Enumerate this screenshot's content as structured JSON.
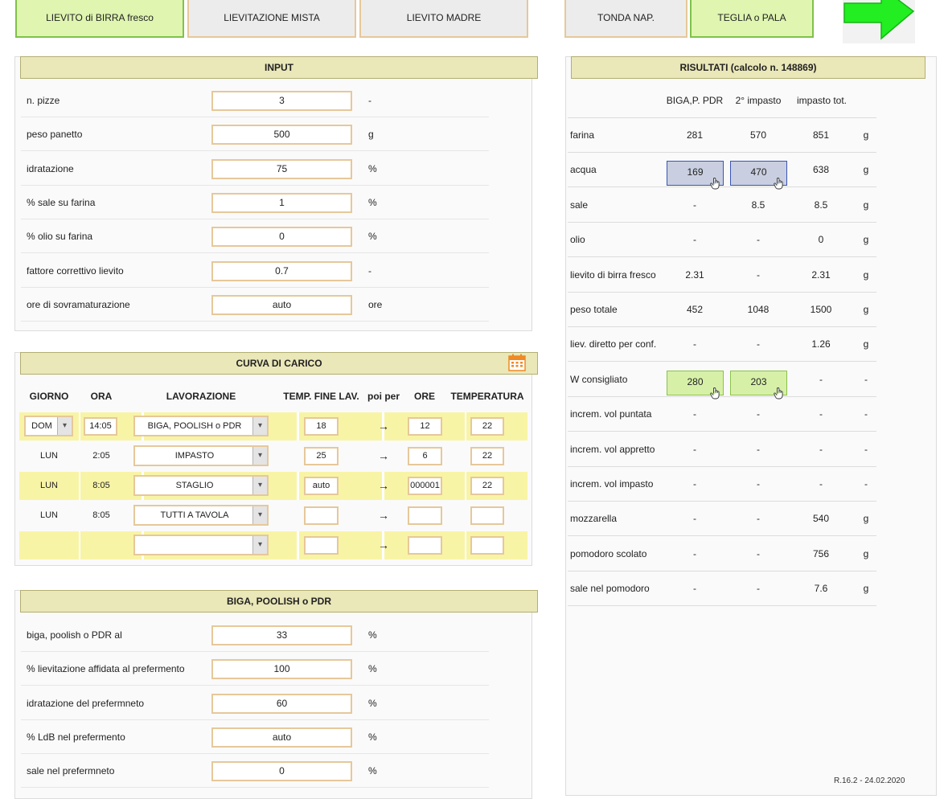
{
  "top_buttons": [
    {
      "label": "LIEVITO di BIRRA fresco",
      "state": "active"
    },
    {
      "label": "LIEVITAZIONE MISTA",
      "state": "normal"
    },
    {
      "label": "LIEVITO MADRE",
      "state": "normal"
    },
    {
      "label": "TONDA NAP.",
      "state": "normal"
    },
    {
      "label": "TEGLIA o PALA",
      "state": "active"
    }
  ],
  "next_button": {
    "icon": "arrow-right-icon",
    "color": "#22ee22"
  },
  "input": {
    "title": "INPUT",
    "rows": [
      {
        "label": "n. pizze",
        "value": "3",
        "unit": "-"
      },
      {
        "label": "peso panetto",
        "value": "500",
        "unit": "g"
      },
      {
        "label": "idratazione",
        "value": "75",
        "unit": "%"
      },
      {
        "label": "% sale su farina",
        "value": "1",
        "unit": "%"
      },
      {
        "label": "% olio su farina",
        "value": "0",
        "unit": "%"
      },
      {
        "label": "fattore correttivo lievito",
        "value": "0.7",
        "unit": "-"
      },
      {
        "label": "ore di sovramaturazione",
        "value": "auto",
        "unit": "ore"
      }
    ]
  },
  "curva": {
    "title": "CURVA DI CARICO",
    "calendar_icon": "calendar-icon",
    "headers": {
      "giorno": "GIORNO",
      "ora": "ORA",
      "lavorazione": "LAVORAZIONE",
      "temp_fine": "TEMP. FINE LAV.",
      "poi_per": "poi per",
      "ore": "ORE",
      "temperatura": "TEMPERATURA"
    },
    "arrow": "→",
    "rows": [
      {
        "giorno": "DOM",
        "ora": "14:05",
        "lavorazione": "BIGA, POOLISH o PDR",
        "temp_fine": "18",
        "ore": "12",
        "temperatura": "22"
      },
      {
        "giorno": "LUN",
        "ora": "2:05",
        "lavorazione": "IMPASTO",
        "temp_fine": "25",
        "ore": "6",
        "temperatura": "22"
      },
      {
        "giorno": "LUN",
        "ora": "8:05",
        "lavorazione": "STAGLIO",
        "temp_fine": "auto",
        "ore": "000001",
        "temperatura": "22"
      },
      {
        "giorno": "LUN",
        "ora": "8:05",
        "lavorazione": "TUTTI A TAVOLA",
        "temp_fine": "",
        "ore": "",
        "temperatura": ""
      },
      {
        "giorno": "",
        "ora": "",
        "lavorazione": "",
        "temp_fine": "",
        "ore": "",
        "temperatura": ""
      }
    ]
  },
  "biga": {
    "title": "BIGA, POOLISH o PDR",
    "rows": [
      {
        "label": "biga, poolish o PDR al",
        "value": "33",
        "unit": "%"
      },
      {
        "label": "% lievitazione affidata al prefermento",
        "value": "100",
        "unit": "%"
      },
      {
        "label": "idratazione del prefermneto",
        "value": "60",
        "unit": "%"
      },
      {
        "label": "% LdB nel prefermento",
        "value": "auto",
        "unit": "%"
      },
      {
        "label": "sale nel prefermneto",
        "value": "0",
        "unit": "%"
      }
    ]
  },
  "results": {
    "title": "RISULTATI (calcolo n. 148869)",
    "col_headers": [
      "BIGA,P. PDR",
      "2° impasto",
      "impasto tot."
    ],
    "rows": [
      {
        "label": "farina",
        "biga": "281",
        "secondo": "570",
        "tot": "851",
        "unit": "g",
        "style": "plain"
      },
      {
        "label": "acqua",
        "biga": "169",
        "secondo": "470",
        "tot": "638",
        "unit": "g",
        "style": "blue"
      },
      {
        "label": "sale",
        "biga": "-",
        "secondo": "8.5",
        "tot": "8.5",
        "unit": "g",
        "style": "plain"
      },
      {
        "label": "olio",
        "biga": "-",
        "secondo": "-",
        "tot": "0",
        "unit": "g",
        "style": "plain"
      },
      {
        "label": "lievito di birra fresco",
        "biga": "2.31",
        "secondo": "-",
        "tot": "2.31",
        "unit": "g",
        "style": "plain"
      },
      {
        "label": "peso totale",
        "biga": "452",
        "secondo": "1048",
        "tot": "1500",
        "unit": "g",
        "style": "plain"
      },
      {
        "label": "liev. diretto per conf.",
        "biga": "-",
        "secondo": "-",
        "tot": "1.26",
        "unit": "g",
        "style": "plain"
      },
      {
        "label": "W consigliato",
        "biga": "280",
        "secondo": "203",
        "tot": "-",
        "unit": "-",
        "style": "green"
      },
      {
        "label": "increm. vol puntata",
        "biga": "-",
        "secondo": "-",
        "tot": "-",
        "unit": "-",
        "style": "plain"
      },
      {
        "label": "increm. vol appretto",
        "biga": "-",
        "secondo": "-",
        "tot": "-",
        "unit": "-",
        "style": "plain"
      },
      {
        "label": "increm. vol impasto",
        "biga": "-",
        "secondo": "-",
        "tot": "-",
        "unit": "-",
        "style": "plain"
      },
      {
        "label": "mozzarella",
        "biga": "-",
        "secondo": "-",
        "tot": "540",
        "unit": "g",
        "style": "plain"
      },
      {
        "label": "pomodoro scolato",
        "biga": "-",
        "secondo": "-",
        "tot": "756",
        "unit": "g",
        "style": "plain"
      },
      {
        "label": "sale nel pomodoro",
        "biga": "-",
        "secondo": "-",
        "tot": "7.6",
        "unit": "g",
        "style": "plain"
      }
    ]
  },
  "version": "R.16.2 - 24.02.2020"
}
